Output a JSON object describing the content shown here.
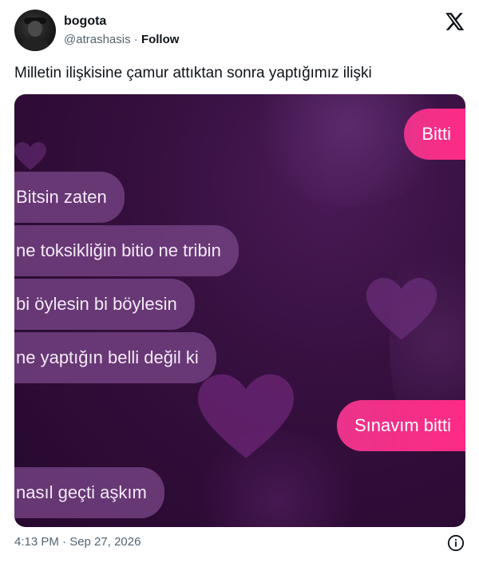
{
  "author": {
    "display_name": "bogota",
    "handle": "@atrashasis",
    "separator": "·",
    "follow_label": "Follow"
  },
  "tweet": {
    "text": "Milletin ilişkisine çamur attıktan sonra yaptığımız ilişki"
  },
  "chat": {
    "messages": [
      {
        "side": "right",
        "text": "Bitti"
      },
      {
        "side": "left",
        "text": "Bitsin zaten"
      },
      {
        "side": "left",
        "text": "ne toksikliğin bitio ne tribin"
      },
      {
        "side": "left",
        "text": "bi öylesin bi böylesin"
      },
      {
        "side": "left",
        "text": "ne yaptığın belli değil ki"
      },
      {
        "side": "right",
        "text": "Sınavım bitti"
      },
      {
        "side": "left",
        "text": "nasıl geçti aşkım"
      }
    ]
  },
  "footer": {
    "timestamp": "4:13 PM · Sep 27, 2026"
  },
  "colors": {
    "outgoing_bubble": "#ff2a86",
    "incoming_bubble": "#744282",
    "background": "#36103f",
    "muted_text": "#536471"
  },
  "icons": {
    "brand": "x-logo-icon",
    "info": "info-icon"
  }
}
